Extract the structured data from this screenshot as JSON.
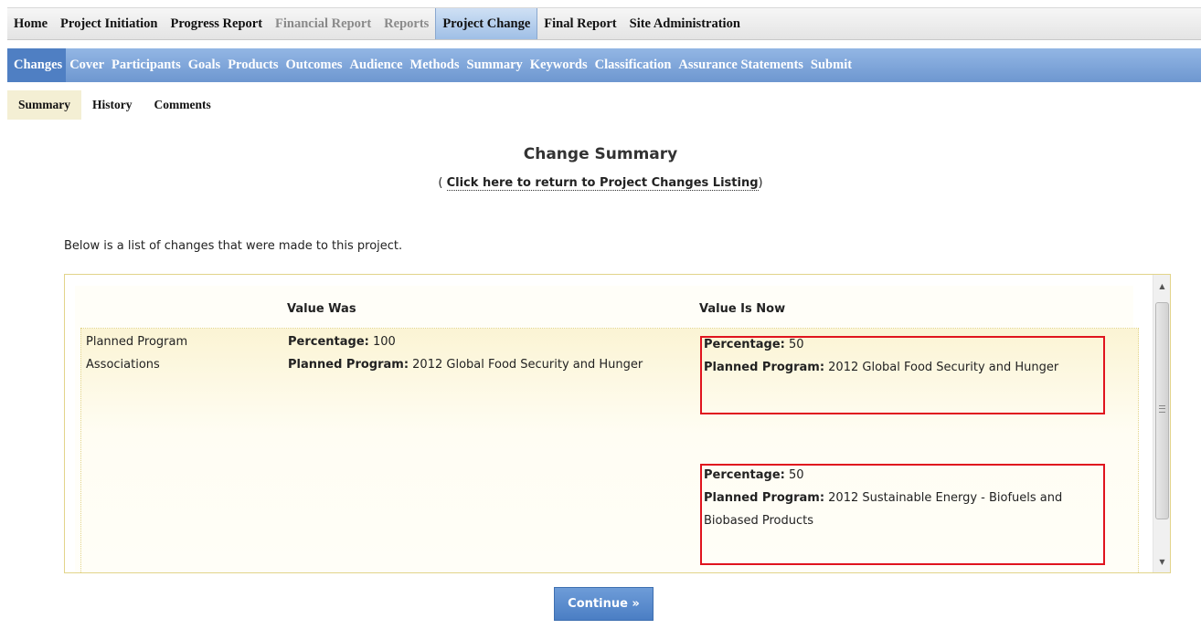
{
  "top_nav": [
    {
      "label": "Home",
      "state": "normal"
    },
    {
      "label": "Project Initiation",
      "state": "normal"
    },
    {
      "label": "Progress Report",
      "state": "normal"
    },
    {
      "label": "Financial Report",
      "state": "disabled"
    },
    {
      "label": "Reports",
      "state": "disabled"
    },
    {
      "label": "Project Change",
      "state": "active"
    },
    {
      "label": "Final Report",
      "state": "normal"
    },
    {
      "label": "Site Administration",
      "state": "normal"
    }
  ],
  "sub_nav": [
    {
      "label": "Changes",
      "active": true
    },
    {
      "label": "Cover",
      "active": false
    },
    {
      "label": "Participants",
      "active": false
    },
    {
      "label": "Goals",
      "active": false
    },
    {
      "label": "Products",
      "active": false
    },
    {
      "label": "Outcomes",
      "active": false
    },
    {
      "label": "Audience",
      "active": false
    },
    {
      "label": "Methods",
      "active": false
    },
    {
      "label": "Summary",
      "active": false
    },
    {
      "label": "Keywords",
      "active": false
    },
    {
      "label": "Classification",
      "active": false
    },
    {
      "label": "Assurance Statements",
      "active": false
    },
    {
      "label": "Submit",
      "active": false
    }
  ],
  "tabs": [
    {
      "label": "Summary",
      "active": true
    },
    {
      "label": "History",
      "active": false
    },
    {
      "label": "Comments",
      "active": false
    }
  ],
  "page": {
    "title": "Change Summary",
    "return_prefix": "( ",
    "return_link": "Click here to return to Project Changes Listing",
    "return_suffix": ")",
    "intro": "Below is a list of changes that were made to this project."
  },
  "changes": {
    "header_was": "Value Was",
    "header_now": "Value Is Now",
    "rows": [
      {
        "field": "Planned Program Associations",
        "was": [
          {
            "label": "Percentage:",
            "value": " 100"
          },
          {
            "label": "Planned Program:",
            "value": " 2012 Global Food Security and Hunger"
          }
        ],
        "now": [
          [
            {
              "label": "Percentage:",
              "value": " 50"
            },
            {
              "label": "Planned Program:",
              "value": " 2012 Global Food Security and Hunger"
            }
          ],
          [
            {
              "label": "Percentage:",
              "value": " 50"
            },
            {
              "label": "Planned Program:",
              "value": " 2012 Sustainable Energy - Biofuels and Biobased Products"
            }
          ]
        ]
      }
    ]
  },
  "continue_label": "Continue »",
  "colors": {
    "highlight_border": "#e0141e",
    "nav_active": "#4f7fc3",
    "panel_border": "#e2d48a"
  }
}
